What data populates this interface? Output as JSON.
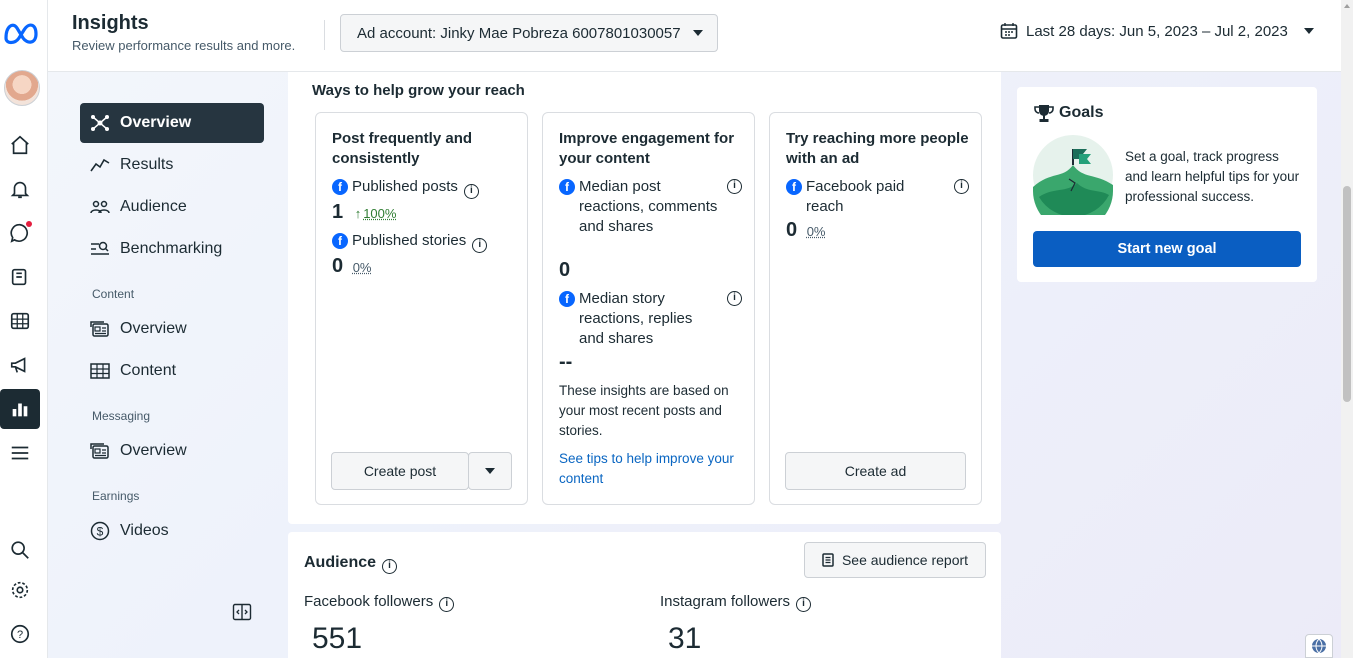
{
  "header": {
    "title": "Insights",
    "subtitle": "Review performance results and more.",
    "ad_account": "Ad account: Jinky Mae Pobreza 6007801030057",
    "date_range": "Last 28 days: Jun 5, 2023 – Jul 2, 2023"
  },
  "rail": {
    "icons": [
      "meta-logo-icon",
      "home-icon",
      "notifications-icon",
      "messages-icon",
      "pages-icon",
      "table-icon",
      "ads-icon",
      "insights-icon",
      "menu-icon",
      "search-icon",
      "settings-icon",
      "help-icon"
    ],
    "accent": "#1c2b33",
    "notification_color": "#e41e3f"
  },
  "sidenav": {
    "items": [
      {
        "label": "Overview",
        "icon": "overview-icon",
        "active": true
      },
      {
        "label": "Results",
        "icon": "results-icon"
      },
      {
        "label": "Audience",
        "icon": "audience-icon"
      },
      {
        "label": "Benchmarking",
        "icon": "benchmarking-icon"
      }
    ],
    "content_section": "Content",
    "content_items": [
      {
        "label": "Overview",
        "icon": "content-overview-icon"
      },
      {
        "label": "Content",
        "icon": "content-table-icon"
      }
    ],
    "messaging_section": "Messaging",
    "messaging_items": [
      {
        "label": "Overview",
        "icon": "messaging-overview-icon"
      }
    ],
    "earnings_section": "Earnings",
    "earnings_items": [
      {
        "label": "Videos",
        "icon": "dollar-icon"
      }
    ]
  },
  "grow": {
    "heading": "Ways to help grow your reach",
    "tiles": [
      {
        "title": "Post frequently and consistently",
        "metrics": [
          {
            "label": "Published posts",
            "value": "1",
            "change": "100%",
            "trend": "up"
          },
          {
            "label": "Published stories",
            "value": "0",
            "change": "0%"
          }
        ],
        "button": "Create post"
      },
      {
        "title": "Improve engagement for your content",
        "metrics": [
          {
            "label": "Median post reactions, comments and shares",
            "value": "0"
          },
          {
            "label": "Median story reactions, replies and shares",
            "value": "--"
          }
        ],
        "note": "These insights are based on your most recent posts and stories.",
        "link": "See tips to help improve your content"
      },
      {
        "title": "Try reaching more people with an ad",
        "metrics": [
          {
            "label": "Facebook paid reach",
            "value": "0",
            "change": "0%"
          }
        ],
        "button": "Create ad"
      }
    ]
  },
  "audience": {
    "heading": "Audience",
    "report_button": "See audience report",
    "facebook_label": "Facebook followers",
    "facebook_value": "551",
    "instagram_label": "Instagram followers",
    "instagram_value": "31"
  },
  "goals": {
    "title": "Goals",
    "text": "Set a goal, track progress and learn helpful tips for your professional success.",
    "button": "Start new goal",
    "button_color": "#0a5ec2"
  },
  "colors": {
    "link": "#0a66c2",
    "facebook": "#0866ff",
    "positive": "#2f7d32"
  }
}
